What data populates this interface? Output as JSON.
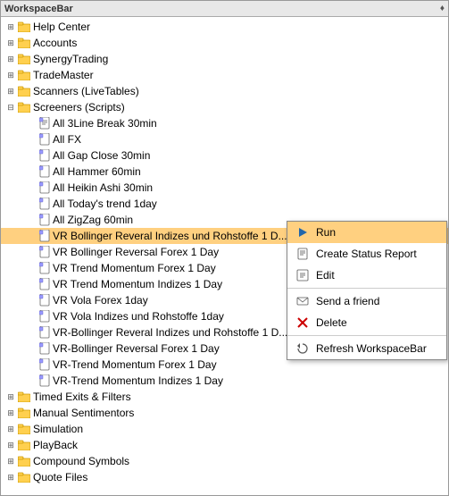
{
  "titleBar": {
    "title": "WorkspaceBar",
    "pin": "♦"
  },
  "tree": {
    "items": [
      {
        "id": "help-center",
        "label": "Help Center",
        "indent": 0,
        "type": "folder",
        "expanded": false
      },
      {
        "id": "accounts",
        "label": "Accounts",
        "indent": 0,
        "type": "folder",
        "expanded": false
      },
      {
        "id": "synergy-trading",
        "label": "SynergyTrading",
        "indent": 0,
        "type": "folder",
        "expanded": false
      },
      {
        "id": "trade-master",
        "label": "TradeMaster",
        "indent": 0,
        "type": "folder",
        "expanded": false
      },
      {
        "id": "scanners",
        "label": "Scanners (LiveTables)",
        "indent": 0,
        "type": "folder",
        "expanded": false
      },
      {
        "id": "screeners",
        "label": "Screeners (Scripts)",
        "indent": 0,
        "type": "folder",
        "expanded": true
      },
      {
        "id": "script1",
        "label": "All 3Line Break 30min",
        "indent": 2,
        "type": "script"
      },
      {
        "id": "script2",
        "label": "All FX",
        "indent": 2,
        "type": "script"
      },
      {
        "id": "script3",
        "label": "All Gap Close 30min",
        "indent": 2,
        "type": "script"
      },
      {
        "id": "script4",
        "label": "All Hammer 60min",
        "indent": 2,
        "type": "script"
      },
      {
        "id": "script5",
        "label": "All Heikin Ashi 30min",
        "indent": 2,
        "type": "script"
      },
      {
        "id": "script6",
        "label": "All Today's trend 1day",
        "indent": 2,
        "type": "script"
      },
      {
        "id": "script7",
        "label": "All ZigZag 60min",
        "indent": 2,
        "type": "script"
      },
      {
        "id": "script8",
        "label": "VR Bollinger Reveral Indizes und Rohstoffe 1 D...",
        "indent": 2,
        "type": "script",
        "selected": true
      },
      {
        "id": "script9",
        "label": "VR Bollinger Reversal Forex 1 Day",
        "indent": 2,
        "type": "script"
      },
      {
        "id": "script10",
        "label": "VR Trend Momentum Forex 1 Day",
        "indent": 2,
        "type": "script"
      },
      {
        "id": "script11",
        "label": "VR Trend Momentum Indizes 1 Day",
        "indent": 2,
        "type": "script"
      },
      {
        "id": "script12",
        "label": "VR Vola Forex 1day",
        "indent": 2,
        "type": "script"
      },
      {
        "id": "script13",
        "label": "VR Vola Indizes und Rohstoffe 1day",
        "indent": 2,
        "type": "script"
      },
      {
        "id": "script14",
        "label": "VR-Bollinger Reveral Indizes und Rohstoffe 1 D...",
        "indent": 2,
        "type": "script"
      },
      {
        "id": "script15",
        "label": "VR-Bollinger Reversal Forex 1 Day",
        "indent": 2,
        "type": "script"
      },
      {
        "id": "script16",
        "label": "VR-Trend Momentum Forex 1 Day",
        "indent": 2,
        "type": "script"
      },
      {
        "id": "script17",
        "label": "VR-Trend Momentum Indizes 1 Day",
        "indent": 2,
        "type": "script"
      },
      {
        "id": "timed-exits",
        "label": "Timed Exits & Filters",
        "indent": 0,
        "type": "folder",
        "expanded": false
      },
      {
        "id": "manual-sentimentors",
        "label": "Manual Sentimentors",
        "indent": 0,
        "type": "folder",
        "expanded": false
      },
      {
        "id": "simulation",
        "label": "Simulation",
        "indent": 0,
        "type": "folder",
        "expanded": false
      },
      {
        "id": "playback",
        "label": "PlayBack",
        "indent": 0,
        "type": "folder",
        "expanded": false
      },
      {
        "id": "compound-symbols",
        "label": "Compound Symbols",
        "indent": 0,
        "type": "folder",
        "expanded": false
      },
      {
        "id": "quote-files",
        "label": "Quote Files",
        "indent": 0,
        "type": "folder",
        "expanded": false
      }
    ]
  },
  "contextMenu": {
    "items": [
      {
        "id": "run",
        "label": "Run",
        "icon": "run",
        "active": true
      },
      {
        "id": "create-status-report",
        "label": "Create Status Report",
        "icon": "report"
      },
      {
        "id": "edit",
        "label": "Edit",
        "icon": "edit"
      },
      {
        "id": "send-friend",
        "label": "Send a friend",
        "icon": "email"
      },
      {
        "id": "delete",
        "label": "Delete",
        "icon": "delete"
      },
      {
        "id": "refresh",
        "label": "Refresh WorkspaceBar",
        "icon": "refresh"
      }
    ]
  }
}
